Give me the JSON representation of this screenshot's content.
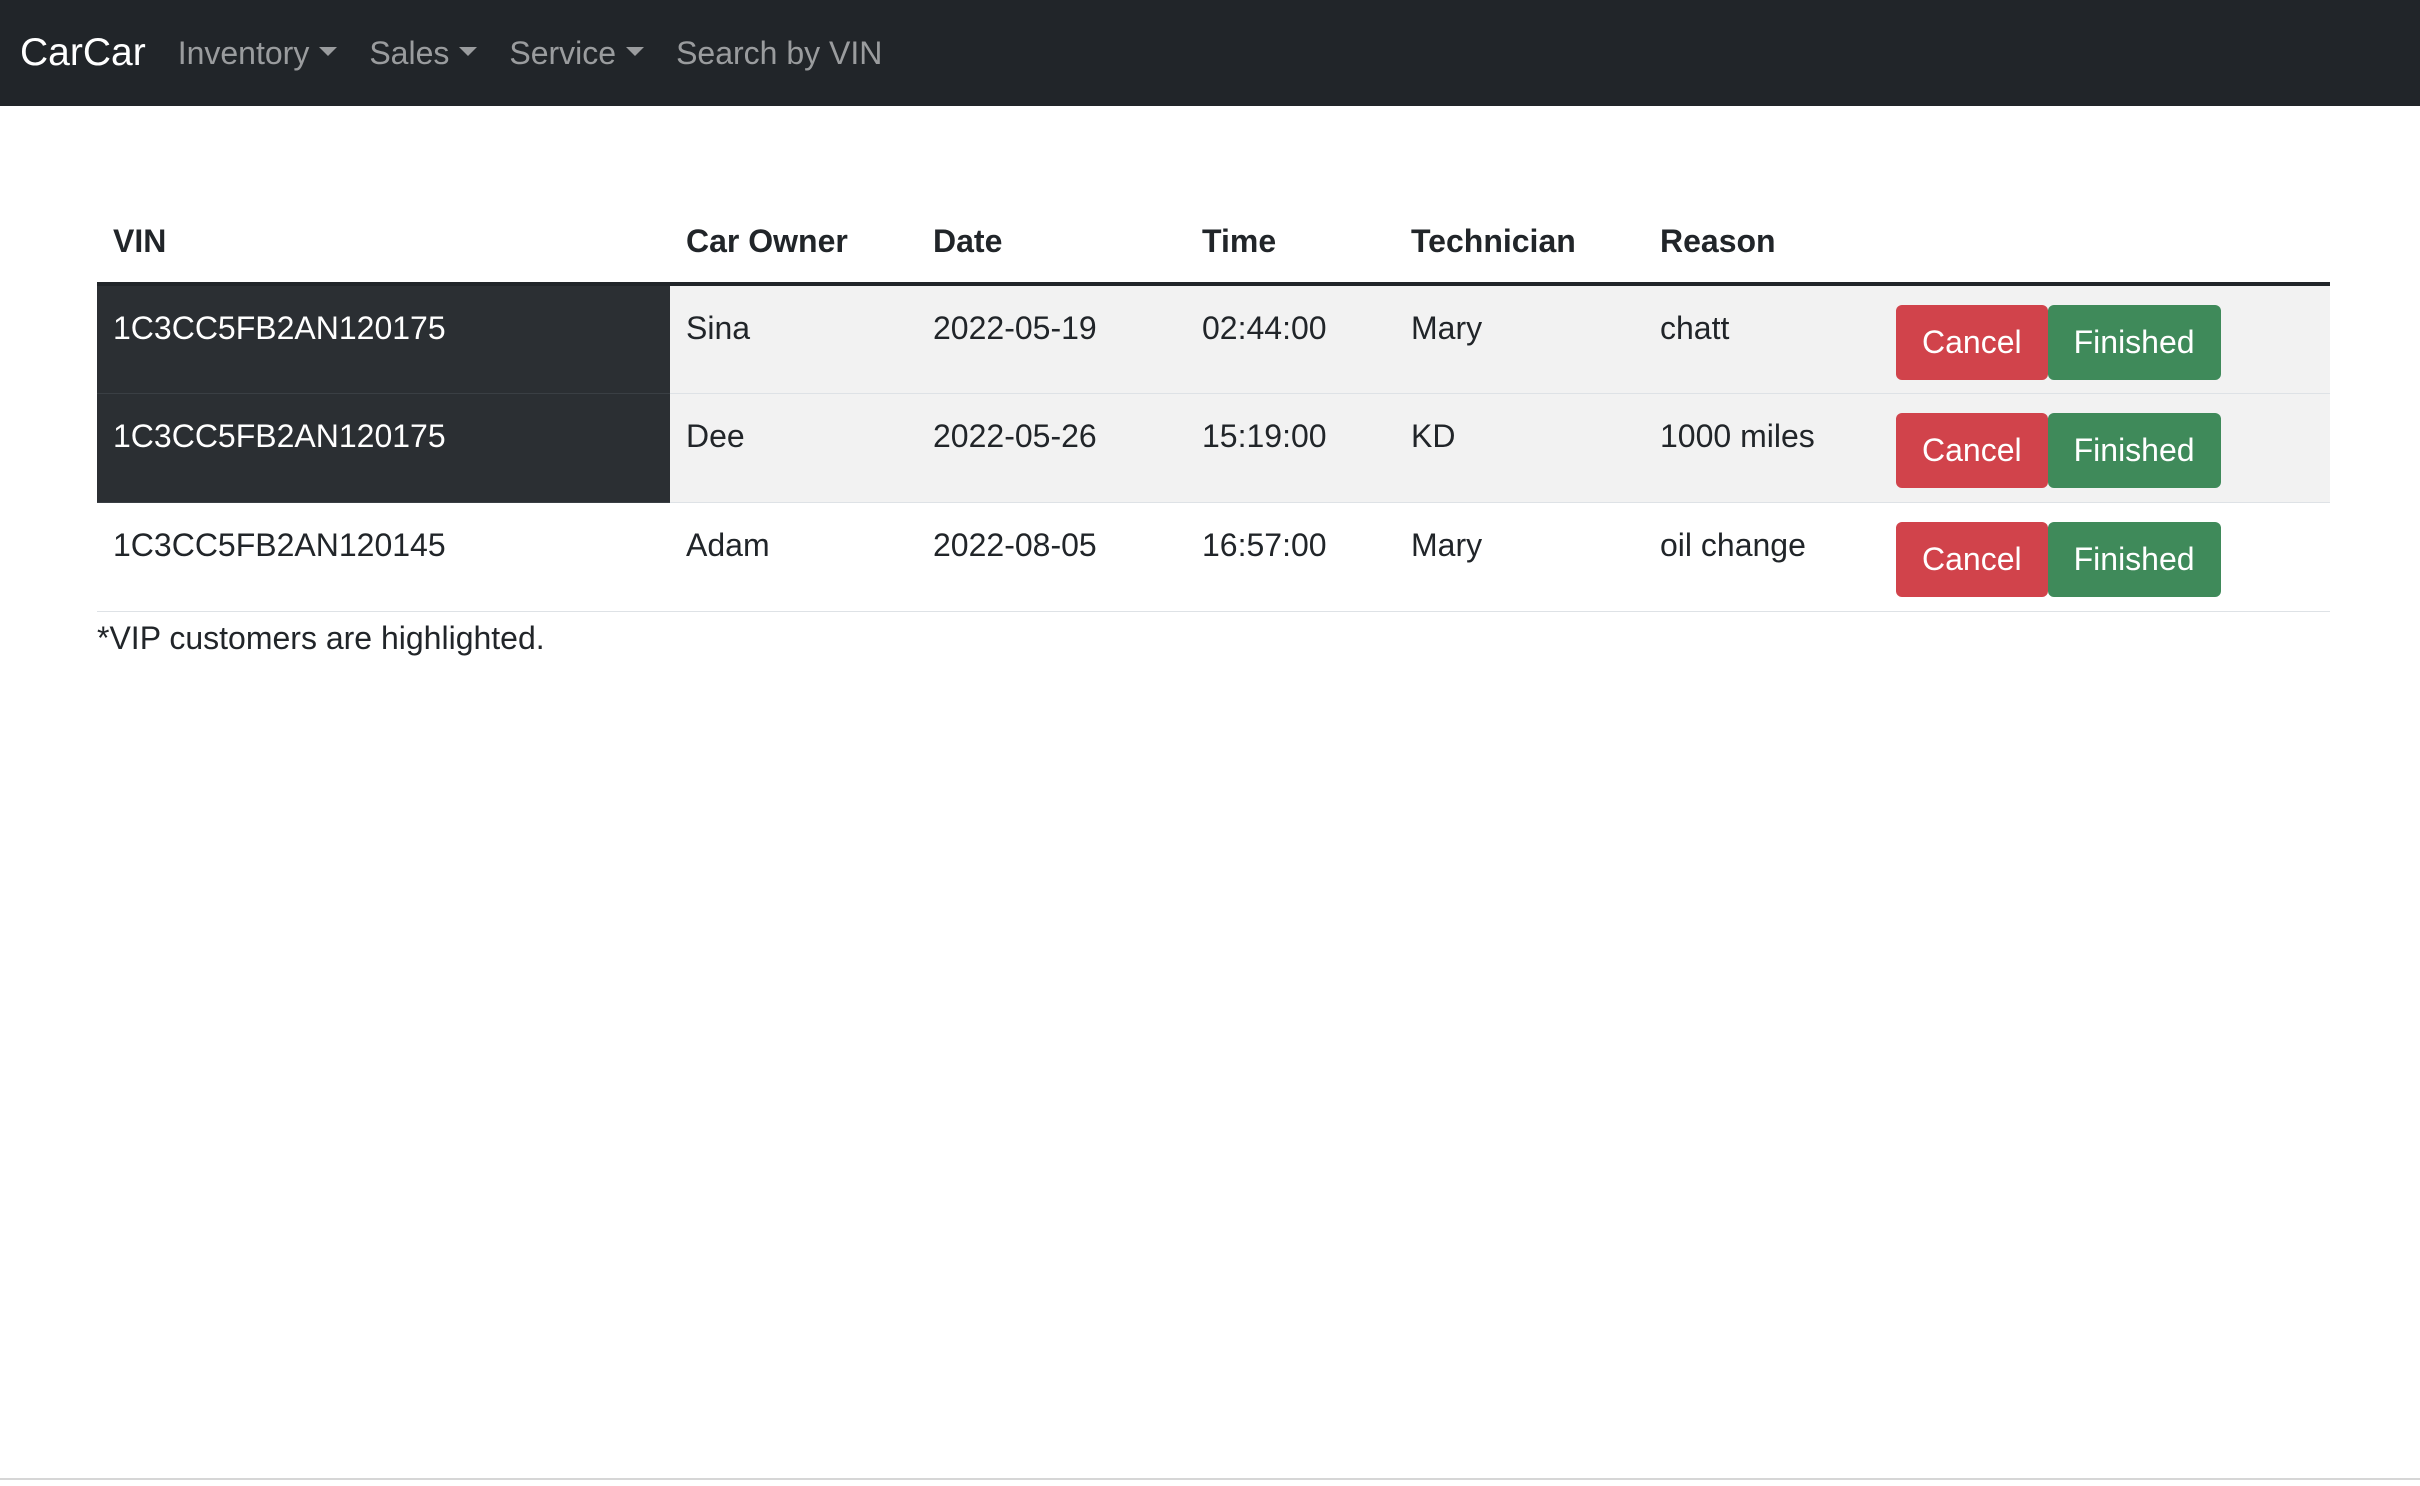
{
  "navbar": {
    "brand": "CarCar",
    "items": [
      {
        "label": "Inventory",
        "dropdown": true
      },
      {
        "label": "Sales",
        "dropdown": true
      },
      {
        "label": "Service",
        "dropdown": true
      },
      {
        "label": "Search by VIN",
        "dropdown": false
      }
    ]
  },
  "table": {
    "headers": [
      "VIN",
      "Car Owner",
      "Date",
      "Time",
      "Technician",
      "Reason",
      ""
    ],
    "rows": [
      {
        "vin": "1C3CC5FB2AN120175",
        "owner": "Sina",
        "date": "2022-05-19",
        "time": "02:44:00",
        "technician": "Mary",
        "reason": "chatt",
        "vip": true
      },
      {
        "vin": "1C3CC5FB2AN120175",
        "owner": "Dee",
        "date": "2022-05-26",
        "time": "15:19:00",
        "technician": "KD",
        "reason": "1000 miles",
        "vip": true
      },
      {
        "vin": "1C3CC5FB2AN120145",
        "owner": "Adam",
        "date": "2022-08-05",
        "time": "16:57:00",
        "technician": "Mary",
        "reason": "oil change",
        "vip": false
      }
    ],
    "cancel_label": "Cancel",
    "finished_label": "Finished"
  },
  "note": "*VIP customers are highlighted.",
  "colors": {
    "navbar_bg": "#212529",
    "vip_highlight": "#2b2f33",
    "cancel": "#d1434b",
    "finished": "#3f8a5a"
  }
}
